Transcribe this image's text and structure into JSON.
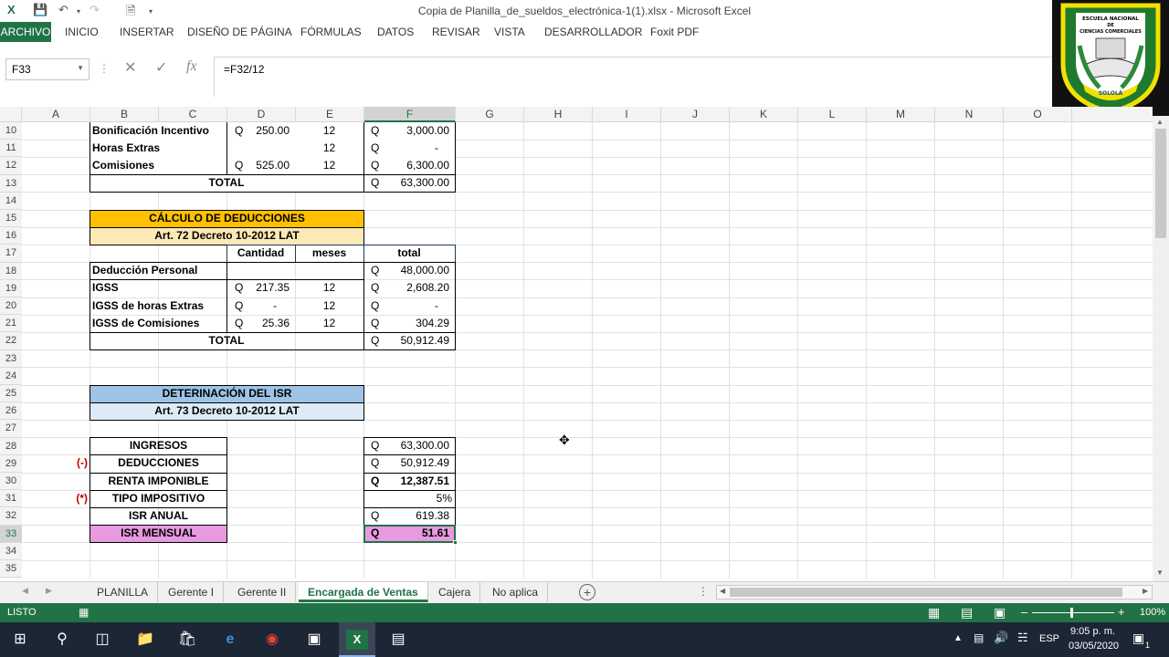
{
  "window": {
    "title": "Copia de Planilla_de_sueldos_electrónica-1(1).xlsx - Microsoft Excel"
  },
  "ribbon": {
    "tabs": [
      "ARCHIVO",
      "INICIO",
      "INSERTAR",
      "DISEÑO DE PÁGINA",
      "FÓRMULAS",
      "DATOS",
      "REVISAR",
      "VISTA",
      "DESARROLLADOR",
      "Foxit PDF"
    ]
  },
  "formula_bar": {
    "name_box": "F33",
    "formula": "=F32/12"
  },
  "columns": [
    "A",
    "B",
    "C",
    "D",
    "E",
    "F",
    "G",
    "H",
    "I",
    "J",
    "K",
    "L",
    "M",
    "N",
    "O"
  ],
  "rows": [
    "10",
    "11",
    "12",
    "13",
    "14",
    "15",
    "16",
    "17",
    "18",
    "19",
    "20",
    "21",
    "22",
    "23",
    "24",
    "25",
    "26",
    "27",
    "28",
    "29",
    "30",
    "31",
    "32",
    "33",
    "34",
    "35"
  ],
  "logo": {
    "text": "ESCUELA NACIONAL DE CIENCIAS COMERCIALES",
    "city": "SOLOLÁ"
  },
  "ingresos_top": {
    "r10": {
      "label": "Bonificación Incentivo",
      "q1": "Q",
      "d": "250.00",
      "e": "12",
      "q2": "Q",
      "f": "3,000.00"
    },
    "r11": {
      "label": "Horas Extras",
      "q1": "",
      "d": "",
      "e": "12",
      "q2": "Q",
      "f": "-"
    },
    "r12": {
      "label": "Comisiones",
      "q1": "Q",
      "d": "525.00",
      "e": "12",
      "q2": "Q",
      "f": "6,300.00"
    },
    "r13": {
      "label": "TOTAL",
      "q2": "Q",
      "f": "63,300.00"
    }
  },
  "deducciones": {
    "title": "CÁLCULO DE DEDUCCIONES",
    "subtitle": "Art. 72 Decreto 10-2012 LAT",
    "headers": {
      "cantidad": "Cantidad",
      "meses": "meses",
      "total": "total"
    },
    "r18": {
      "label": "Deducción Personal",
      "q2": "Q",
      "f": "48,000.00"
    },
    "r19": {
      "label": "IGSS",
      "q1": "Q",
      "d": "217.35",
      "e": "12",
      "q2": "Q",
      "f": "2,608.20"
    },
    "r20": {
      "label": "IGSS de horas Extras",
      "q1": "Q",
      "d": "-",
      "e": "12",
      "q2": "Q",
      "f": "-"
    },
    "r21": {
      "label": "IGSS de Comisiones",
      "q1": "Q",
      "d": "25.36",
      "e": "12",
      "q2": "Q",
      "f": "304.29"
    },
    "r22": {
      "label": "TOTAL",
      "q2": "Q",
      "f": "50,912.49"
    }
  },
  "isr": {
    "title": "DETERINACIÓN DEL ISR",
    "subtitle": "Art. 73 Decreto 10-2012 LAT",
    "r28": {
      "label": "INGRESOS",
      "q2": "Q",
      "f": "63,300.00"
    },
    "r29": {
      "op": "(-)",
      "label": "DEDUCCIONES",
      "q2": "Q",
      "f": "50,912.49"
    },
    "r30": {
      "label": "RENTA IMPONIBLE",
      "q2": "Q",
      "f": "12,387.51"
    },
    "r31": {
      "op": "(*)",
      "label": "TIPO IMPOSITIVO",
      "f": "5%"
    },
    "r32": {
      "label": "ISR ANUAL",
      "q2": "Q",
      "f": "619.38"
    },
    "r33": {
      "label": "ISR MENSUAL",
      "q2": "Q",
      "f": "51.61"
    }
  },
  "sheet_tabs": [
    "PLANILLA",
    "Gerente I",
    "Gerente II",
    "Encargada de Ventas",
    "Cajera",
    "No aplica"
  ],
  "active_sheet": "Encargada de Ventas",
  "status": {
    "mode": "LISTO",
    "zoom": "100%"
  },
  "taskbar": {
    "language": "ESP",
    "time": "9:05 p. m.",
    "date": "03/05/2020",
    "notifications": "1"
  },
  "colors": {
    "excel_green": "#217346",
    "orange": "#ffc000",
    "blue": "#9dc3e6",
    "pink": "#e89ae0"
  }
}
